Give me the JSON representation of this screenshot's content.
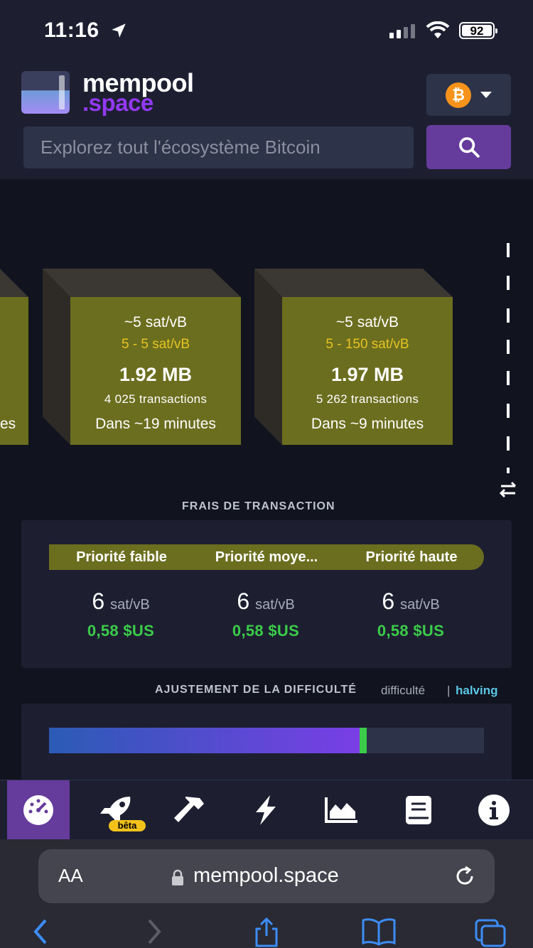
{
  "status": {
    "time": "11:16",
    "battery": "92"
  },
  "header": {
    "logo_line1": "mempool",
    "logo_line2": ".space",
    "network_symbol": "₿",
    "search_placeholder": "Explorez tout l'écosystème Bitcoin"
  },
  "blocks": [
    {
      "fee": "~5 sat/vB",
      "range": "5 - 5 sat/vB",
      "size": "1.92 MB",
      "transactions": "4 025 transactions",
      "time": "Dans ~19 minutes"
    },
    {
      "fee": "~5 sat/vB",
      "range": "5 - 150 sat/vB",
      "size": "1.97 MB",
      "transactions": "5 262 transactions",
      "time": "Dans ~9 minutes"
    }
  ],
  "partial_block_text": "es",
  "fees": {
    "title": "FRAIS DE TRANSACTION",
    "tiers": [
      "Priorité faible",
      "Priorité moye...",
      "Priorité haute"
    ],
    "values": [
      {
        "rate": "6",
        "unit": "sat/vB",
        "usd": "0,58 $US"
      },
      {
        "rate": "6",
        "unit": "sat/vB",
        "usd": "0,58 $US"
      },
      {
        "rate": "6",
        "unit": "sat/vB",
        "usd": "0,58 $US"
      }
    ]
  },
  "difficulty": {
    "title": "AJUSTEMENT DE LA DIFFICULTÉ",
    "link_difficulty": "difficulté",
    "separator": "|",
    "link_halving": "halving",
    "progress": 0.72
  },
  "nav": {
    "items": [
      "dashboard-icon",
      "rocket-icon",
      "hammer-icon",
      "lightning-icon",
      "chart-icon",
      "docs-icon",
      "info-icon"
    ],
    "beta_label": "bêta"
  },
  "browser": {
    "aa_label": "AA",
    "url": "mempool.space"
  },
  "colors": {
    "accent": "#653b9c",
    "block": "#6b6e1e",
    "usd": "#3bcc49",
    "halving": "#5bc7e4"
  }
}
